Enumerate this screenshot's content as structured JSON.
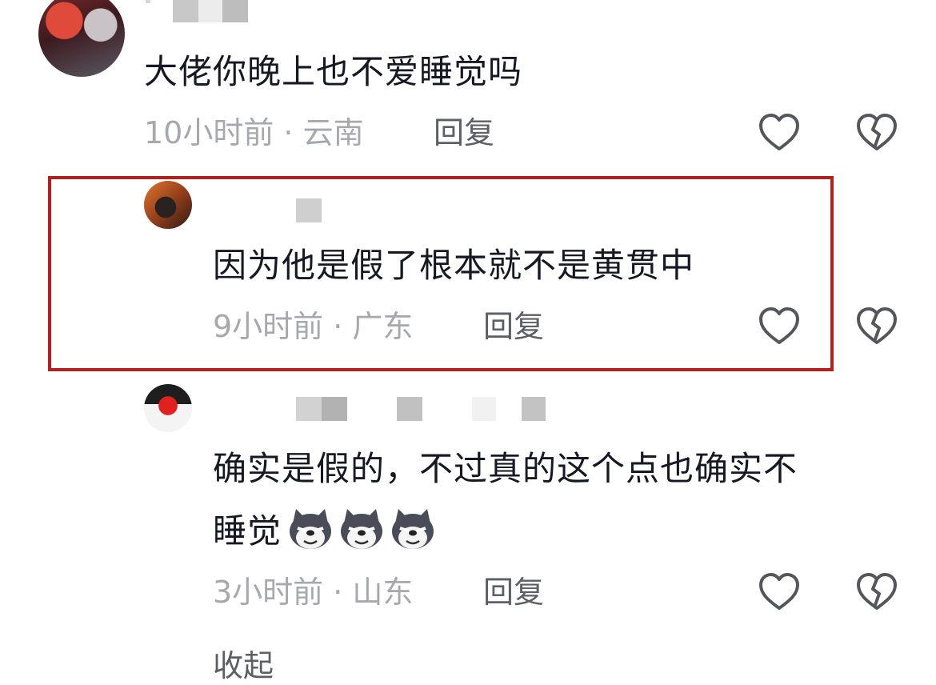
{
  "comments": [
    {
      "text": "大佬你晚上也不爱睡觉吗",
      "meta": "10小时前 · 云南",
      "reply_label": "回复"
    },
    {
      "text": "因为他是假了根本就不是黄贯中",
      "meta": "9小时前 · 广东",
      "reply_label": "回复"
    },
    {
      "text_line1": "确实是假的，不过真的这个点也确实不",
      "text_line2": "睡觉",
      "meta": "3小时前 · 山东",
      "reply_label": "回复"
    }
  ],
  "collapse_label": "收起",
  "colors": {
    "highlight_border": "#b3201e",
    "meta_gray": "#a7a8ad",
    "reply_gray": "#5d5f66"
  },
  "icons": [
    "heart-outline-icon",
    "broken-heart-icon",
    "husky-emoji"
  ]
}
